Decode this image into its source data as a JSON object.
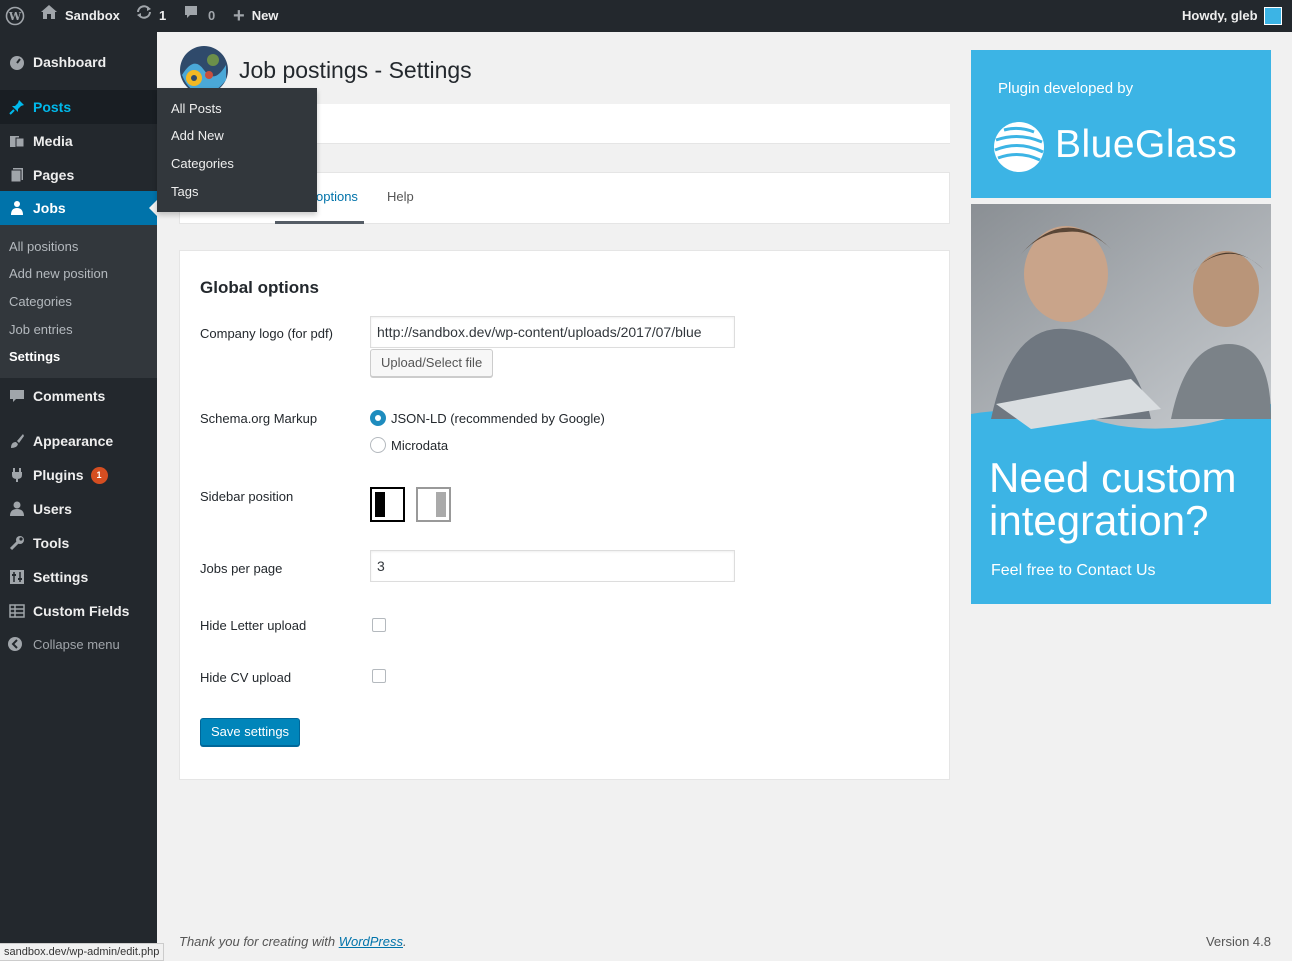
{
  "admin_bar": {
    "site_name": "Sandbox",
    "updates_count": "1",
    "comments_count": "0",
    "new_label": "New",
    "howdy": "Howdy, gleb"
  },
  "menu": {
    "dashboard": "Dashboard",
    "posts": "Posts",
    "media": "Media",
    "pages": "Pages",
    "jobs": "Jobs",
    "jobs_sub": [
      "All positions",
      "Add new position",
      "Categories",
      "Job entries",
      "Settings"
    ],
    "comments": "Comments",
    "appearance": "Appearance",
    "plugins": "Plugins",
    "plugins_badge": "1",
    "users": "Users",
    "tools": "Tools",
    "settings": "Settings",
    "custom_fields": "Custom Fields",
    "collapse": "Collapse menu"
  },
  "flyout": [
    "All Posts",
    "Add New",
    "Categories",
    "Tags"
  ],
  "page": {
    "title": "Job postings - Settings",
    "tab_options_visible": "options",
    "tab_help": "Help"
  },
  "settings": {
    "section_title": "Global options",
    "company_logo_label": "Company logo (for pdf)",
    "company_logo_value": "http://sandbox.dev/wp-content/uploads/2017/07/blue",
    "upload_button": "Upload/Select file",
    "schema_label": "Schema.org Markup",
    "schema_options": [
      "JSON-LD (recommended by Google)",
      "Microdata"
    ],
    "sidebar_label": "Sidebar position",
    "jobs_per_page_label": "Jobs per page",
    "jobs_per_page_value": "3",
    "hide_letter_label": "Hide Letter upload",
    "hide_cv_label": "Hide CV upload",
    "save_button": "Save settings"
  },
  "ad": {
    "developed_by": "Plugin developed by",
    "brand": "BlueGlass",
    "headline_1": "Need custom",
    "headline_2": "integration?",
    "contact": "Feel free to Contact Us",
    "color": "#3cb4e5"
  },
  "footer": {
    "thanks_prefix": "Thank you for creating with ",
    "wp_link": "WordPress",
    "period": ".",
    "version": "Version 4.8"
  },
  "status_url": "sandbox.dev/wp-admin/edit.php"
}
